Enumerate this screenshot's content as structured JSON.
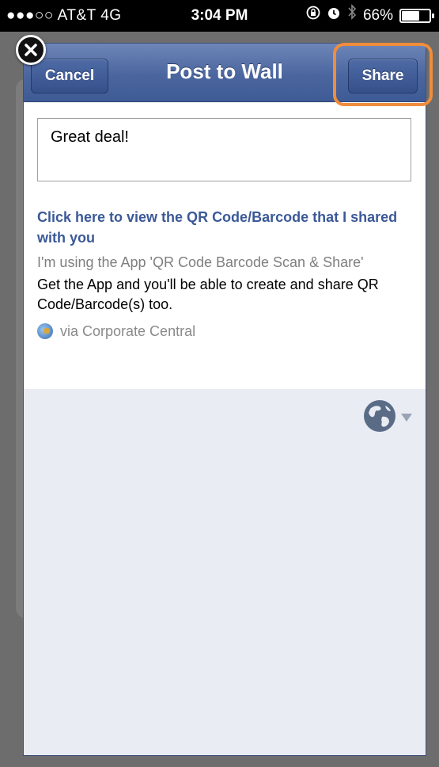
{
  "status_bar": {
    "carrier": "●●●○○ AT&T  4G",
    "time": "3:04 PM",
    "battery_percent": "66%",
    "battery_level": 0.66
  },
  "dialog": {
    "title": "Post to Wall",
    "cancel_label": "Cancel",
    "share_label": "Share",
    "message": "Great deal!",
    "attachment": {
      "link_title": "Click here to view the QR Code/Barcode that I shared with you",
      "caption": "I'm using the App 'QR Code Barcode Scan & Share'",
      "description": "Get the App and you'll be able to create and share QR Code/Barcode(s) too.",
      "via": "via Corporate Central"
    }
  },
  "colors": {
    "navbar": "#4b669f",
    "link": "#3b5998",
    "highlight": "#f08d3c"
  },
  "icons": [
    "close-icon",
    "globe-icon",
    "chevron-down-icon",
    "app-icon",
    "lock-rotation-icon",
    "alarm-icon",
    "bluetooth-icon",
    "battery-icon"
  ]
}
